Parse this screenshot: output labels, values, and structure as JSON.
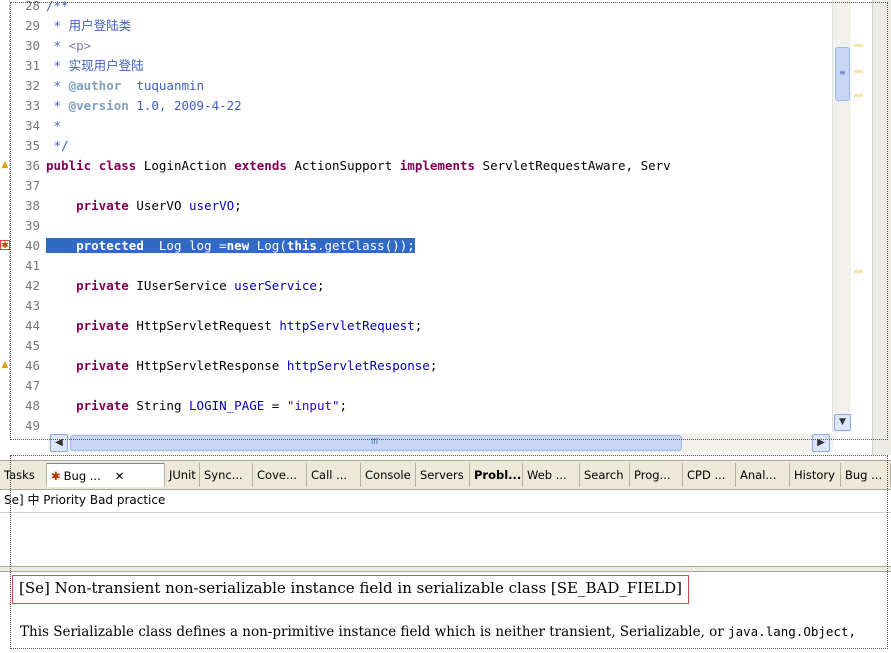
{
  "editor": {
    "lines": [
      {
        "num": "28",
        "parts": [
          {
            "t": "/**",
            "c": "cm"
          }
        ]
      },
      {
        "num": "29",
        "parts": [
          {
            "t": " * 用户登陆类",
            "c": "cm"
          }
        ]
      },
      {
        "num": "30",
        "parts": [
          {
            "t": " * ",
            "c": "cm"
          },
          {
            "t": "<p>",
            "c": "tag"
          }
        ]
      },
      {
        "num": "31",
        "parts": [
          {
            "t": " * 实现用户登陆",
            "c": "cm"
          }
        ]
      },
      {
        "num": "32",
        "parts": [
          {
            "t": " * ",
            "c": "cm"
          },
          {
            "t": "@author",
            "c": "ann"
          },
          {
            "t": "  tuquanmin",
            "c": "cm"
          }
        ]
      },
      {
        "num": "33",
        "parts": [
          {
            "t": " * ",
            "c": "cm"
          },
          {
            "t": "@version",
            "c": "ann"
          },
          {
            "t": " 1.0, 2009-4-22",
            "c": "cm"
          }
        ]
      },
      {
        "num": "34",
        "parts": [
          {
            "t": " *",
            "c": "cm"
          }
        ]
      },
      {
        "num": "35",
        "parts": [
          {
            "t": " */",
            "c": "cm"
          }
        ]
      },
      {
        "num": "36",
        "parts": [
          {
            "t": "public",
            "c": "kw"
          },
          {
            "t": " "
          },
          {
            "t": "class",
            "c": "kw"
          },
          {
            "t": " "
          },
          {
            "t": "LoginAction",
            "c": "sq"
          },
          {
            "t": " "
          },
          {
            "t": "extends",
            "c": "kw"
          },
          {
            "t": " ActionSupport "
          },
          {
            "t": "implements",
            "c": "kw"
          },
          {
            "t": " ServletRequestAware, Serv"
          }
        ]
      },
      {
        "num": "37",
        "parts": []
      },
      {
        "num": "38",
        "parts": [
          {
            "t": "    "
          },
          {
            "t": "private",
            "c": "kw"
          },
          {
            "t": " UserVO "
          },
          {
            "t": "userVO",
            "c": "fld"
          },
          {
            "t": ";"
          }
        ]
      },
      {
        "num": "39",
        "parts": []
      },
      {
        "num": "40",
        "hl": true,
        "parts": [
          {
            "t": "    ",
            "c": "sel"
          },
          {
            "t": "protected",
            "c": "sel b"
          },
          {
            "t": "  Log log =",
            "c": "sel"
          },
          {
            "t": "new",
            "c": "sel b"
          },
          {
            "t": " Log(",
            "c": "sel"
          },
          {
            "t": "this",
            "c": "sel b"
          },
          {
            "t": ".getClass());",
            "c": "sel"
          }
        ]
      },
      {
        "num": "41",
        "parts": []
      },
      {
        "num": "42",
        "parts": [
          {
            "t": "    "
          },
          {
            "t": "private",
            "c": "kw"
          },
          {
            "t": " IUserService "
          },
          {
            "t": "userService",
            "c": "fld"
          },
          {
            "t": ";"
          }
        ]
      },
      {
        "num": "43",
        "parts": []
      },
      {
        "num": "44",
        "parts": [
          {
            "t": "    "
          },
          {
            "t": "private",
            "c": "kw"
          },
          {
            "t": " HttpServletRequest "
          },
          {
            "t": "httpServletRequest",
            "c": "fld"
          },
          {
            "t": ";"
          }
        ]
      },
      {
        "num": "45",
        "parts": []
      },
      {
        "num": "46",
        "parts": [
          {
            "t": "    "
          },
          {
            "t": "private",
            "c": "kw"
          },
          {
            "t": " HttpServletResponse "
          },
          {
            "t": "httpServletResponse",
            "c": "fld sq"
          },
          {
            "t": ";"
          }
        ]
      },
      {
        "num": "47",
        "parts": []
      },
      {
        "num": "48",
        "parts": [
          {
            "t": "    "
          },
          {
            "t": "private",
            "c": "kw"
          },
          {
            "t": " String "
          },
          {
            "t": "LOGIN_PAGE",
            "c": "fld"
          },
          {
            "t": " = "
          },
          {
            "t": "\"input\"",
            "c": "str"
          },
          {
            "t": ";"
          }
        ]
      },
      {
        "num": "49",
        "parts": []
      }
    ]
  },
  "tabs": [
    {
      "label": "Tasks",
      "name": "tab-tasks"
    },
    {
      "label": "Bug ...",
      "name": "tab-bug-explorer",
      "active": true,
      "icon": "bug-icon"
    },
    {
      "label": "JUnit",
      "name": "tab-junit"
    },
    {
      "label": "Sync...",
      "name": "tab-synchronize"
    },
    {
      "label": "Cove...",
      "name": "tab-coverage"
    },
    {
      "label": "Call ...",
      "name": "tab-call-hierarchy"
    },
    {
      "label": "Console",
      "name": "tab-console"
    },
    {
      "label": "Servers",
      "name": "tab-servers"
    },
    {
      "label": "Probl...",
      "name": "tab-problems",
      "bold": true
    },
    {
      "label": "Web ...",
      "name": "tab-web"
    },
    {
      "label": "Search",
      "name": "tab-search"
    },
    {
      "label": "Prog...",
      "name": "tab-progress"
    },
    {
      "label": "CPD ...",
      "name": "tab-cpd"
    },
    {
      "label": "Anal...",
      "name": "tab-analysis"
    },
    {
      "label": "History",
      "name": "tab-history"
    },
    {
      "label": "Bug ...",
      "name": "tab-bug-info"
    }
  ],
  "close_glyph": "✕",
  "bug_list": {
    "row": "Se] 中 Priority Bad practice"
  },
  "bug_detail": {
    "title": "[Se] Non-transient non-serializable instance field in serializable class [SE_BAD_FIELD]",
    "desc_text": "This Serializable class defines a non-primitive instance field which is neither transient, Serializable, or ",
    "desc_code": "java.lang.Object,"
  },
  "scroll": {
    "h_thumb_glyph": "III",
    "v_thumb_glyph": "≡",
    "left_arrow": "◀",
    "right_arrow": "▶",
    "down_arrow": "▼"
  },
  "colors": {
    "selection": "#316ac5",
    "keyword": "#7f0055",
    "comment": "#3f5fbf",
    "field": "#0000c0",
    "string": "#2a00ff",
    "bug_border": "#d84848"
  }
}
